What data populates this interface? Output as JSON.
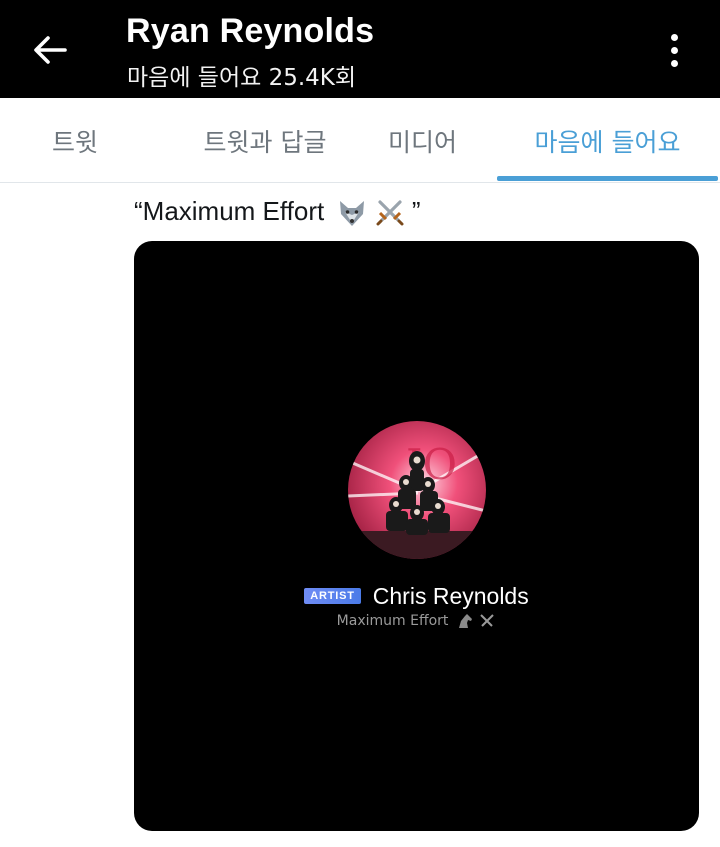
{
  "header": {
    "title": "Ryan Reynolds",
    "subtitle": "마음에 들어요 25.4K회",
    "back_icon": "back-arrow-icon",
    "menu_icon": "more-vertical-icon"
  },
  "tabs": [
    {
      "label": "트윗"
    },
    {
      "label": "트윗과 답글"
    },
    {
      "label": "미디어"
    },
    {
      "label": "마음에 들어요",
      "active": true
    }
  ],
  "tweet": {
    "text": "“Maximum Effort",
    "text_close": "”",
    "emoji": [
      "wolf-icon",
      "crossed-swords-icon"
    ]
  },
  "media": {
    "badge": "ARTIST",
    "name": "Chris Reynolds",
    "bio": "Maximum Effort",
    "bio_emoji": [
      "horse-icon",
      "crossed-swords-icon"
    ]
  },
  "colors": {
    "accent": "#4a9fd6",
    "header_bg": "#000000",
    "tab_inactive": "#6e767d"
  }
}
